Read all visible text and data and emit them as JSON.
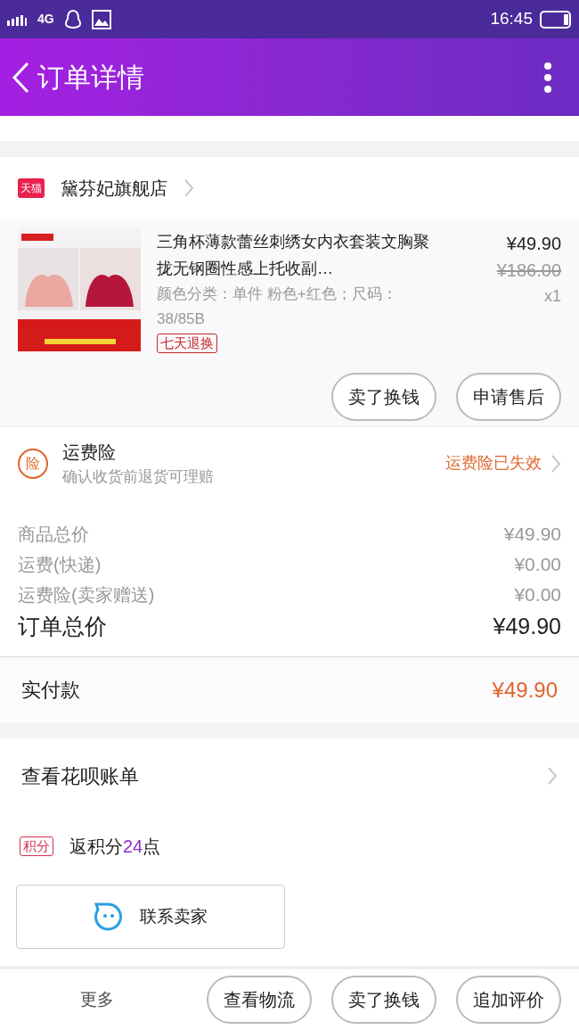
{
  "status_bar": {
    "network": "4G",
    "time": "16:45"
  },
  "header": {
    "title": "订单详情"
  },
  "shop": {
    "badge": "天猫",
    "name": "黛芬妃旗舰店"
  },
  "product": {
    "image": {
      "kind": "picture"
    },
    "title": "三角杯薄款蕾丝刺绣女内衣套装文胸聚拢无钢圈性感上托收副…",
    "spec": "颜色分类：单件 粉色+红色；尺码：38/85B",
    "tag": "七天退换",
    "price": "¥49.90",
    "original_price": "¥186.00",
    "quantity": "x1",
    "actions": [
      "卖了换钱",
      "申请售后"
    ]
  },
  "insurance": {
    "icon_text": "险",
    "title": "运费险",
    "subtitle": "确认收货前退货可理赔",
    "status": "运费险已失效"
  },
  "summary": [
    {
      "label": "商品总价",
      "value": "¥49.90",
      "kind": "minor"
    },
    {
      "label": "运费(快递)",
      "value": "¥0.00",
      "kind": "minor"
    },
    {
      "label": "运费险(卖家赠送)",
      "value": "¥0.00",
      "kind": "minor"
    },
    {
      "label": "订单总价",
      "value": "¥49.90",
      "kind": "total"
    }
  ],
  "payment": {
    "label": "实付款",
    "value": "¥49.90"
  },
  "huabei": {
    "label": "查看花呗账单"
  },
  "points": {
    "badge": "积分",
    "before": "返积分",
    "value": "24",
    "after": "点"
  },
  "contact": {
    "label": "联系卖家"
  },
  "bottom_bar": {
    "more": "更多",
    "buttons": [
      "查看物流",
      "卖了换钱",
      "追加评价"
    ]
  }
}
